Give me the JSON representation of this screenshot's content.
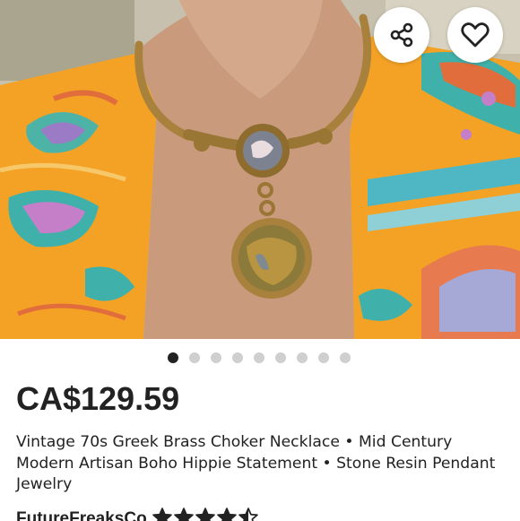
{
  "icons": {
    "share": "share-icon",
    "favorite": "heart-icon"
  },
  "gallery": {
    "image_count": 9,
    "active_index": 0
  },
  "listing": {
    "price": "CA$129.59",
    "title": "Vintage 70s Greek Brass Choker Necklace • Mid Century Modern Artisan Boho Hippie Statement • Stone Resin Pendant Jewelry"
  },
  "seller": {
    "name": "FutureFreaksCo",
    "rating": 4.5,
    "rating_max": 5
  },
  "colors": {
    "text": "#222222",
    "dot_active": "#222222",
    "dot_inactive": "#cfcfcf",
    "button_bg": "#ffffff",
    "fabric_orange": "#f3a226",
    "fabric_teal": "#3fb1aa",
    "brass": "#a8823c"
  }
}
